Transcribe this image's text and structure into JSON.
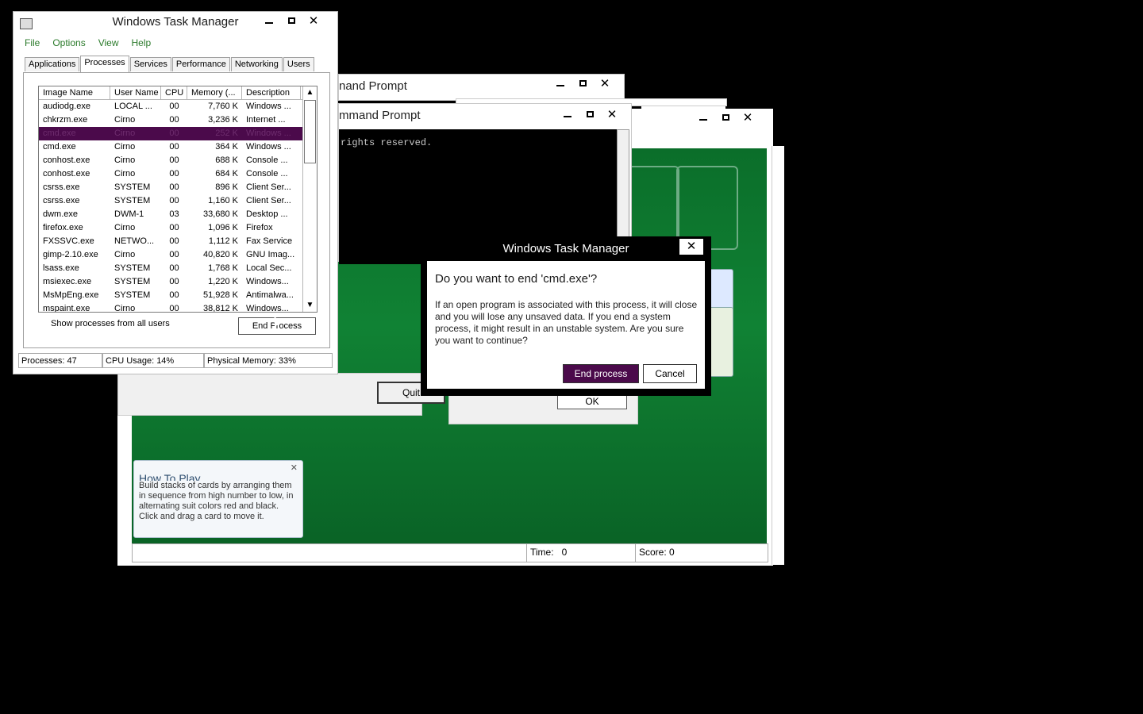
{
  "task_manager": {
    "title": "Windows Task Manager",
    "menu": [
      "File",
      "Options",
      "View",
      "Help"
    ],
    "tabs": [
      "Applications",
      "Processes",
      "Services",
      "Performance",
      "Networking",
      "Users"
    ],
    "active_tab": "Processes",
    "columns": [
      "Image Name",
      "User Name",
      "CPU",
      "Memory (...",
      "Description"
    ],
    "rows": [
      {
        "image": "audiodg.exe",
        "user": "LOCAL ...",
        "cpu": "00",
        "memory": "7,760 K",
        "desc": "Windows ..."
      },
      {
        "image": "chkrzm.exe",
        "user": "Cirno",
        "cpu": "00",
        "memory": "3,236 K",
        "desc": "Internet ..."
      },
      {
        "image": "cmd.exe",
        "user": "Cirno",
        "cpu": "00",
        "memory": "252 K",
        "desc": "Windows ..."
      },
      {
        "image": "cmd.exe",
        "user": "Cirno",
        "cpu": "00",
        "memory": "364 K",
        "desc": "Windows ..."
      },
      {
        "image": "conhost.exe",
        "user": "Cirno",
        "cpu": "00",
        "memory": "688 K",
        "desc": "Console ..."
      },
      {
        "image": "conhost.exe",
        "user": "Cirno",
        "cpu": "00",
        "memory": "684 K",
        "desc": "Console ..."
      },
      {
        "image": "csrss.exe",
        "user": "SYSTEM",
        "cpu": "00",
        "memory": "896 K",
        "desc": "Client Ser..."
      },
      {
        "image": "csrss.exe",
        "user": "SYSTEM",
        "cpu": "00",
        "memory": "1,160 K",
        "desc": "Client Ser..."
      },
      {
        "image": "dwm.exe",
        "user": "DWM-1",
        "cpu": "03",
        "memory": "33,680 K",
        "desc": "Desktop ..."
      },
      {
        "image": "firefox.exe",
        "user": "Cirno",
        "cpu": "00",
        "memory": "1,096 K",
        "desc": "Firefox"
      },
      {
        "image": "FXSSVC.exe",
        "user": "NETWO...",
        "cpu": "00",
        "memory": "1,112 K",
        "desc": "Fax Service"
      },
      {
        "image": "gimp-2.10.exe",
        "user": "Cirno",
        "cpu": "00",
        "memory": "40,820 K",
        "desc": "GNU Imag..."
      },
      {
        "image": "lsass.exe",
        "user": "SYSTEM",
        "cpu": "00",
        "memory": "1,768 K",
        "desc": "Local Sec..."
      },
      {
        "image": "msiexec.exe",
        "user": "SYSTEM",
        "cpu": "00",
        "memory": "1,220 K",
        "desc": "Windows..."
      },
      {
        "image": "MsMpEng.exe",
        "user": "SYSTEM",
        "cpu": "00",
        "memory": "51,928 K",
        "desc": "Antimalwa..."
      },
      {
        "image": "mspaint.exe",
        "user": "Cirno",
        "cpu": "00",
        "memory": "38,812 K",
        "desc": "Windows..."
      }
    ],
    "selected_row": 2,
    "show_all_label": "Show processes from all users",
    "end_process_label": "End Process",
    "status": {
      "processes": "Processes: 47",
      "cpu": "CPU Usage: 14%",
      "memory": "Physical Memory: 33%"
    }
  },
  "cmd_windows": [
    {
      "title": "nand Prompt"
    },
    {
      "title": "mmand Prompt",
      "content": "rights reserved."
    }
  ],
  "confirm_dialog": {
    "title": "Windows Task Manager",
    "question": "Do you want to end 'cmd.exe'?",
    "message": "If an open program is associated with this process, it will close and you will lose any unsaved data. If you end a system process, it might result in an unstable system. Are you sure you want to continue?",
    "end_label": "End process",
    "cancel_label": "Cancel"
  },
  "quit_dialog": {
    "quit_label": "Quit"
  },
  "ok_dialog": {
    "ok_label": "OK"
  },
  "solitaire": {
    "howto_title": "How To Play",
    "howto_text": "Build stacks of cards by arranging them in sequence from high number to low, in alternating suit colors red and black. Click and drag a card to move it.",
    "time_label": "Time:",
    "time_value": "0",
    "score": "Score: 0"
  },
  "colors": {
    "selection": "#4b0a4b",
    "felt": "#108234",
    "menu_text": "#2a7a2a"
  }
}
